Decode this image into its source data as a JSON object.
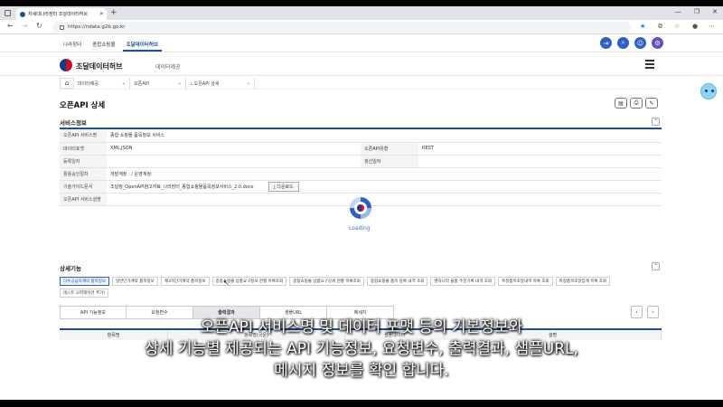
{
  "browser": {
    "tab_title": "차세대나라장터 조달데이터허브",
    "url": "https://ndata.g2b.go.kr"
  },
  "topnav": [
    "나라장터",
    "종합쇼핑몰",
    "조달데이터허브"
  ],
  "site": {
    "logo_text": "조달데이터허브",
    "sub_nav": "데이터제공"
  },
  "breadcrumb": [
    "데이터제공",
    "오픈API",
    "ㄴ오픈API 상세"
  ],
  "page_title": "오픈API 상세",
  "service_section": {
    "title": "서비스정보",
    "rows": [
      {
        "k1": "오픈API 서비스명",
        "v1": "종합 쇼핑몰 품목정보 서비스",
        "k2": "",
        "v2": ""
      },
      {
        "k1": "데이터포맷",
        "v1": "XML,JSON",
        "k2": "오픈API유형",
        "v2": "REST"
      },
      {
        "k1": "등록일자",
        "v1": "",
        "k2": "갱신일자",
        "v2": ""
      },
      {
        "k1": "활용승인절차",
        "v1": "개발계정 : / 운영계정:",
        "k2": "",
        "v2": ""
      },
      {
        "k1": "기술가이드문서",
        "v1": "조달청_OpenAPI참고자료_나라장터_종합쇼핑몰품목정보서비스_2.0.docx",
        "k2": "",
        "v2": ""
      },
      {
        "k1": "오픈API 서비스설명",
        "v1": "",
        "k2": "",
        "v2": ""
      }
    ],
    "download_label": "⤓ 다운로드"
  },
  "detail_section": {
    "title": "상세기능",
    "functions": [
      "다수공급자계약 품목정보",
      "일반단가계약 품목정보",
      "제3자단가계약 품목정보",
      "종합쇼핑몰 납품요구정보 현황 목록조회",
      "종합쇼핑몰 납품요구상세 현황 목록조회",
      "종합쇼핑몰 품목 등록 내역 조회",
      "벤처나라 물품 주문기록 내역 조회",
      "특정품목조달내역 목록 조회",
      "특정품목조달집계 목록 조회",
      "테스트 오퍼레이션 추가!"
    ],
    "tabs": [
      "API 기능정보",
      "요청변수",
      "출력결과",
      "샘플URL",
      "메세지"
    ],
    "table_headers": [
      "항목명",
      "항목명(국문)",
      "샘플데이터",
      "설명"
    ]
  },
  "loading_text": "Loading",
  "caption": [
    "오픈API 서비스명 및 데이터 포맷 등의 기본정보와",
    "상세 기능별 제공되는 API 기능정보, 요청변수, 출력결과, 샘플URL,",
    "메시지 정보를 확인 합니다."
  ],
  "colors": {
    "accent": "#1d4f9c",
    "button": "#2f5fc4"
  }
}
